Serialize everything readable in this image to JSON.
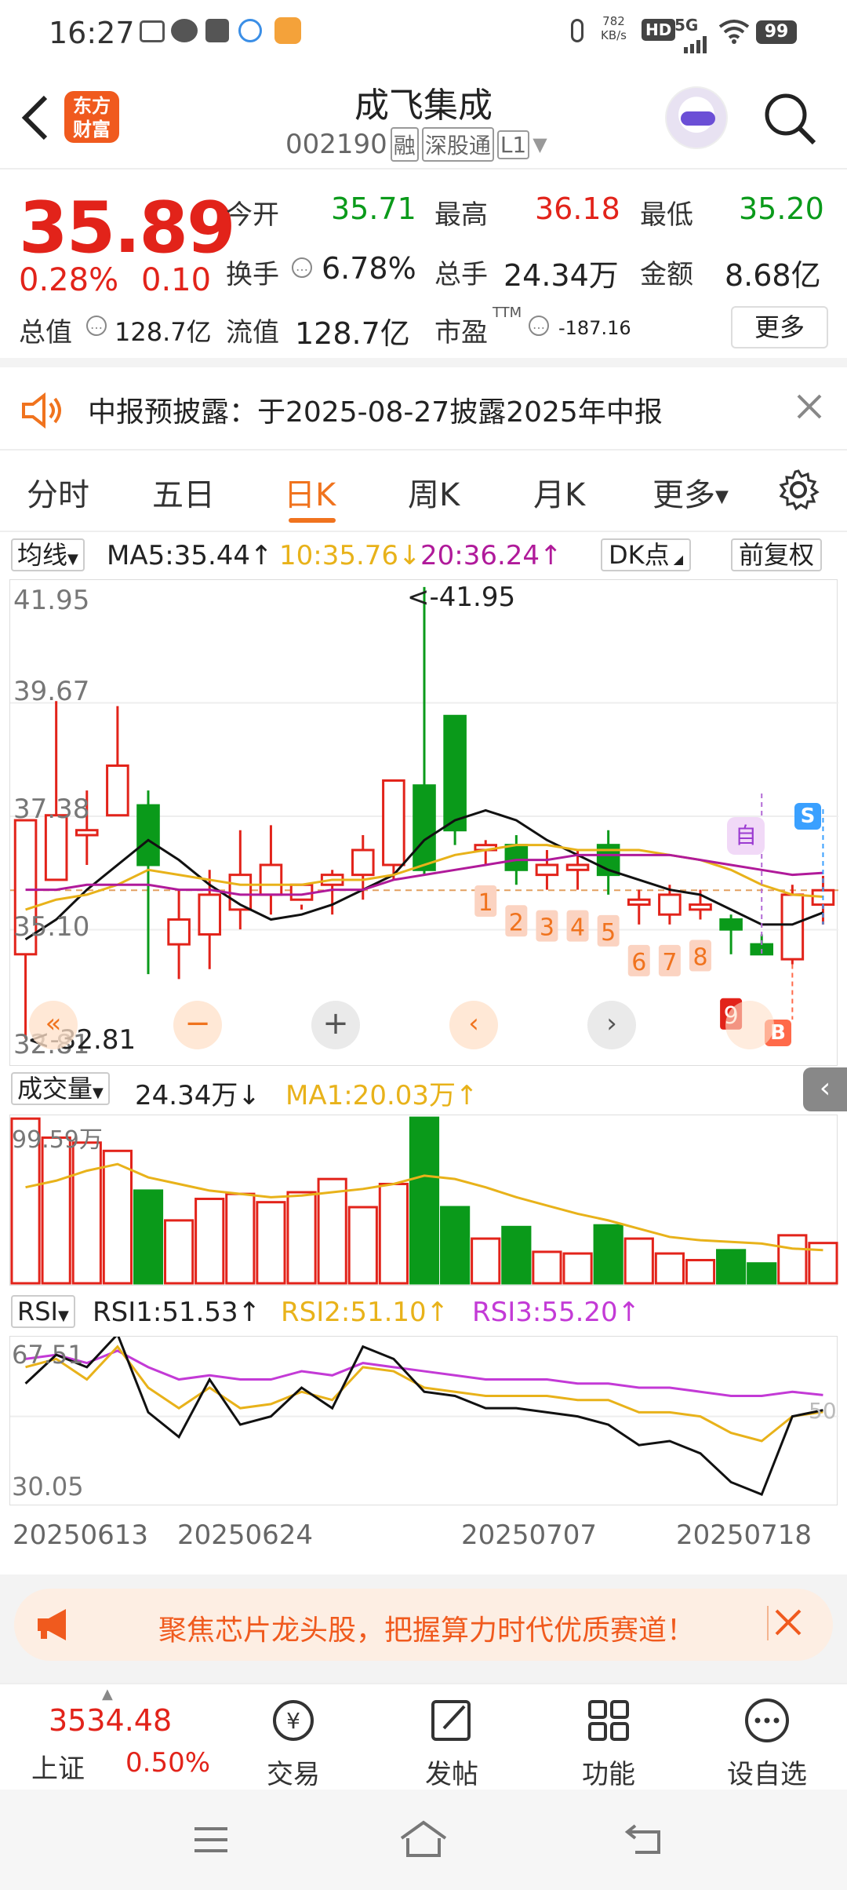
{
  "status": {
    "time": "16:27",
    "net_speed_value": "782",
    "net_speed_unit": "KB/s",
    "hd": "HD",
    "signal": "5G",
    "battery": "99"
  },
  "header": {
    "logo_line1": "东方",
    "logo_line2": "财富",
    "stock_name": "成飞集成",
    "stock_code": "002190",
    "tag_margin": "融",
    "tag_connect": "深股通",
    "tag_level": "L1"
  },
  "quote": {
    "price": "35.89",
    "change_pct": "0.28%",
    "change": "0.10",
    "open_label": "今开",
    "open": "35.71",
    "high_label": "最高",
    "high": "36.18",
    "low_label": "最低",
    "low": "35.20",
    "turnover_label": "换手",
    "turnover": "6.78%",
    "volume_label": "总手",
    "volume": "24.34万",
    "amount_label": "金额",
    "amount": "8.68亿",
    "mktcap_label": "总值",
    "mktcap": "128.7亿",
    "float_label": "流值",
    "float": "128.7亿",
    "pe_label": "市盈",
    "pe_sup": "TTM",
    "pe": "-187.16",
    "more": "更多"
  },
  "notice": {
    "text": "中报预披露：于2025-08-27披露2025年中报"
  },
  "tabs": {
    "items": [
      "分时",
      "五日",
      "日K",
      "周K",
      "月K",
      "更多"
    ],
    "active": 2
  },
  "kline": {
    "ma_selector": "均线",
    "ma5": "MA5:35.44",
    "ma5_arrow": "↑",
    "ma10": "10:35.76",
    "ma10_arrow": "↓",
    "ma20": "20:36.24",
    "ma20_arrow": "↑",
    "dk_button": "DK点",
    "adjust_button": "前复权",
    "y_labels": [
      "41.95",
      "39.67",
      "37.38",
      "35.10",
      "32.81"
    ],
    "high_marker": "<-41.95",
    "low_marker": "<-32.81",
    "buy_tag": "B",
    "sell_tag": "S",
    "self_tag": "自"
  },
  "volume": {
    "selector": "成交量",
    "value": "24.34万",
    "value_arrow": "↓",
    "ma1": "MA1:20.03万",
    "ma1_arrow": "↑",
    "max_label": "99.59万"
  },
  "rsi": {
    "selector": "RSI",
    "rsi1": "RSI1:51.53",
    "rsi1_arrow": "↑",
    "rsi2": "RSI2:51.10",
    "rsi2_arrow": "↑",
    "rsi3": "RSI3:55.20",
    "rsi3_arrow": "↑",
    "top_label": "67.51",
    "bottom_label": "30.05",
    "mid_label": "50"
  },
  "dates": [
    "20250613",
    "20250624",
    "20250707",
    "20250718"
  ],
  "banner": {
    "text": "聚焦芯片龙头股，把握算力时代优质赛道！"
  },
  "bottom_nav": {
    "index_value": "3534.48",
    "index_name": "上证",
    "index_pct": "0.50%",
    "items": [
      "交易",
      "发帖",
      "功能",
      "设自选"
    ]
  },
  "colors": {
    "up": "#e2231a",
    "down": "#0a9a1a",
    "accent": "#f0731e"
  },
  "chart_data": {
    "type": "candlestick",
    "ylim": [
      32.81,
      41.95
    ],
    "candles": [
      {
        "o": 34.6,
        "c": 37.3,
        "h": 37.3,
        "l": 32.9
      },
      {
        "o": 36.1,
        "c": 37.4,
        "h": 39.7,
        "l": 36.1
      },
      {
        "o": 37.0,
        "c": 37.1,
        "h": 37.9,
        "l": 36.4
      },
      {
        "o": 37.4,
        "c": 38.4,
        "h": 39.6,
        "l": 37.4
      },
      {
        "o": 37.6,
        "c": 36.4,
        "h": 37.9,
        "l": 34.2
      },
      {
        "o": 34.8,
        "c": 35.3,
        "h": 35.9,
        "l": 34.1
      },
      {
        "o": 35.0,
        "c": 35.8,
        "h": 36.3,
        "l": 34.3
      },
      {
        "o": 35.5,
        "c": 36.2,
        "h": 37.1,
        "l": 35.1
      },
      {
        "o": 35.8,
        "c": 36.4,
        "h": 37.2,
        "l": 35.4
      },
      {
        "o": 35.7,
        "c": 36.0,
        "h": 35.6,
        "l": 35.5
      },
      {
        "o": 36.0,
        "c": 36.2,
        "h": 36.3,
        "l": 35.4
      },
      {
        "o": 36.2,
        "c": 36.7,
        "h": 37.0,
        "l": 35.7
      },
      {
        "o": 36.4,
        "c": 38.1,
        "h": 38.1,
        "l": 36.1
      },
      {
        "o": 38.0,
        "c": 36.3,
        "h": 42.0,
        "l": 36.2
      },
      {
        "o": 39.4,
        "c": 37.1,
        "h": 39.4,
        "l": 36.8
      },
      {
        "o": 36.7,
        "c": 36.8,
        "h": 36.9,
        "l": 36.4
      },
      {
        "o": 36.8,
        "c": 36.3,
        "h": 37.0,
        "l": 36.0
      },
      {
        "o": 36.2,
        "c": 36.4,
        "h": 36.7,
        "l": 35.9
      },
      {
        "o": 36.3,
        "c": 36.4,
        "h": 36.7,
        "l": 35.9
      },
      {
        "o": 36.8,
        "c": 36.2,
        "h": 37.1,
        "l": 35.8
      },
      {
        "o": 35.6,
        "c": 35.7,
        "h": 35.9,
        "l": 35.2
      },
      {
        "o": 35.4,
        "c": 35.8,
        "h": 36.0,
        "l": 35.2
      },
      {
        "o": 35.5,
        "c": 35.6,
        "h": 35.9,
        "l": 35.3
      },
      {
        "o": 35.3,
        "c": 35.1,
        "h": 35.4,
        "l": 34.6
      },
      {
        "o": 34.8,
        "c": 34.6,
        "h": 35.0,
        "l": 34.6
      },
      {
        "o": 34.5,
        "c": 35.8,
        "h": 36.0,
        "l": 34.4
      },
      {
        "o": 35.6,
        "c": 35.89,
        "h": 36.18,
        "l": 35.2
      }
    ],
    "ma5": [
      34.9,
      35.3,
      35.9,
      36.4,
      36.9,
      36.5,
      36.0,
      35.6,
      35.3,
      35.4,
      35.6,
      35.9,
      36.2,
      36.9,
      37.3,
      37.5,
      37.3,
      36.9,
      36.6,
      36.3,
      36.1,
      35.9,
      35.8,
      35.5,
      35.2,
      35.2,
      35.44
    ],
    "ma10": [
      35.5,
      35.7,
      35.8,
      36.0,
      36.3,
      36.2,
      36.1,
      36.0,
      36.0,
      36.0,
      36.1,
      36.1,
      36.2,
      36.4,
      36.6,
      36.7,
      36.8,
      36.8,
      36.7,
      36.7,
      36.7,
      36.6,
      36.5,
      36.3,
      36.0,
      35.8,
      35.76
    ],
    "ma20": [
      35.9,
      35.9,
      36.0,
      36.0,
      36.0,
      35.9,
      35.9,
      35.8,
      35.8,
      35.8,
      35.9,
      35.9,
      36.1,
      36.2,
      36.3,
      36.4,
      36.5,
      36.5,
      36.6,
      36.6,
      36.6,
      36.6,
      36.5,
      36.4,
      36.3,
      36.2,
      36.24
    ],
    "volume": {
      "max": 99.59,
      "values": [
        99.5,
        88,
        85,
        80,
        56,
        38,
        51,
        54,
        49,
        55,
        63,
        46,
        60,
        100,
        46,
        27,
        34,
        19,
        18,
        35,
        27,
        18,
        14,
        20,
        12,
        29,
        24.34
      ],
      "ma": [
        58,
        62,
        68,
        72,
        64,
        60,
        56,
        54,
        52,
        53,
        55,
        57,
        60,
        65,
        63,
        58,
        52,
        47,
        42,
        38,
        33,
        28,
        26,
        25,
        24,
        21,
        20.03
      ]
    },
    "rsi": {
      "ylim": [
        30.05,
        67.51
      ],
      "rsi1": [
        58,
        65,
        62,
        70,
        51,
        45,
        59,
        48,
        50,
        57,
        52,
        67,
        64,
        56,
        55,
        52,
        52,
        51,
        50,
        48,
        43,
        44,
        41,
        34,
        31,
        50,
        51.53
      ],
      "rsi2": [
        62,
        64,
        59,
        67,
        57,
        52,
        57,
        52,
        53,
        56,
        54,
        62,
        61,
        57,
        56,
        55,
        55,
        55,
        54,
        54,
        51,
        51,
        50,
        46,
        44,
        50,
        51.1
      ],
      "rsi3": [
        64,
        65,
        63,
        66,
        62,
        59,
        60,
        59,
        59,
        61,
        60,
        63,
        62,
        61,
        60,
        59,
        59,
        59,
        58,
        58,
        57,
        57,
        56,
        55,
        55,
        56,
        55.2
      ]
    }
  }
}
